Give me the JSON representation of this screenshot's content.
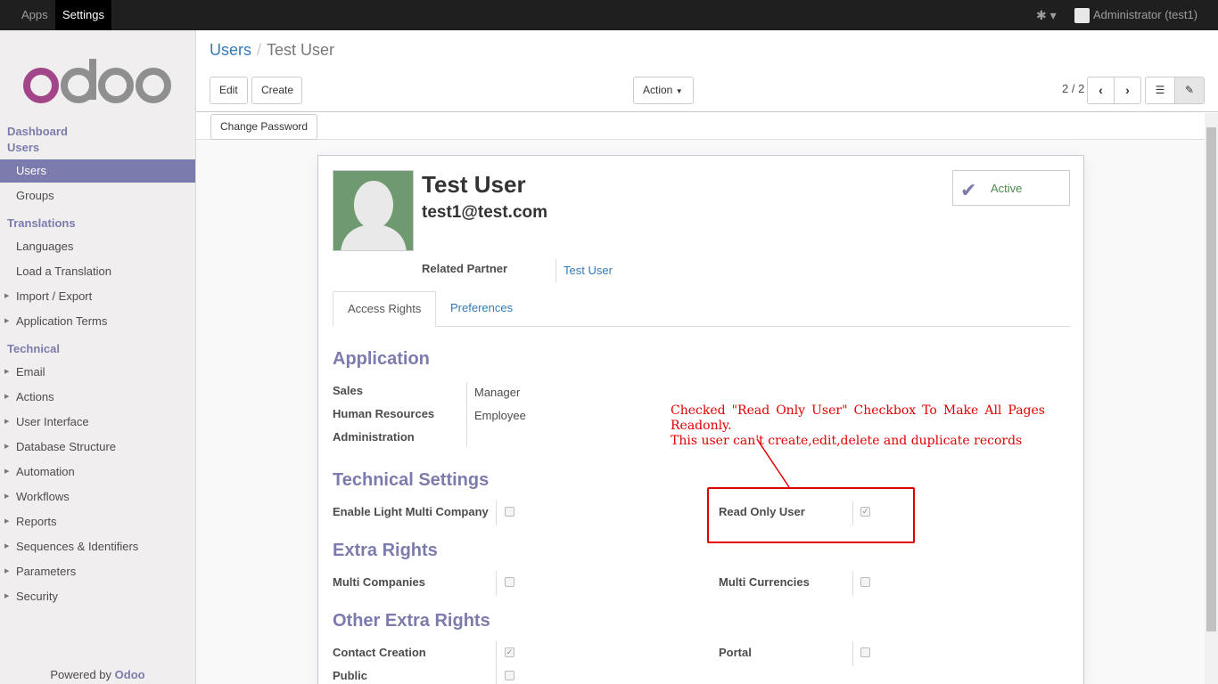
{
  "topbar": {
    "apps_label": "Apps",
    "settings_label": "Settings",
    "user_label": "Administrator (test1)"
  },
  "sidebar": {
    "logo_text": "odoo",
    "sections": {
      "dashboard": "Dashboard",
      "users": "Users",
      "translations": "Translations",
      "technical": "Technical"
    },
    "items": {
      "users": "Users",
      "groups": "Groups",
      "languages": "Languages",
      "load_translation": "Load a Translation",
      "import_export": "Import / Export",
      "application_terms": "Application Terms",
      "email": "Email",
      "actions": "Actions",
      "user_interface": "User Interface",
      "database_structure": "Database Structure",
      "automation": "Automation",
      "workflows": "Workflows",
      "reports": "Reports",
      "sequences": "Sequences & Identifiers",
      "parameters": "Parameters",
      "security": "Security"
    },
    "powered_by": "Powered by",
    "powered_brand": "Odoo"
  },
  "control": {
    "breadcrumb_parent": "Users",
    "breadcrumb_sep": "/",
    "breadcrumb_current": "Test User",
    "edit_label": "Edit",
    "create_label": "Create",
    "action_label": "Action",
    "pager": "2 / 2"
  },
  "statusbar": {
    "change_password_label": "Change Password"
  },
  "form": {
    "name": "Test User",
    "email": "test1@test.com",
    "active_label": "Active",
    "related_partner_label": "Related Partner",
    "related_partner_value": "Test User",
    "tabs": {
      "access_rights": "Access Rights",
      "preferences": "Preferences"
    },
    "application": {
      "title": "Application",
      "sales_label": "Sales",
      "sales_value": "Manager",
      "hr_label": "Human Resources",
      "hr_value": "Employee",
      "admin_label": "Administration"
    },
    "technical": {
      "title": "Technical Settings",
      "light_multi_company": "Enable Light Multi Company",
      "read_only_user": "Read Only User"
    },
    "extra": {
      "title": "Extra Rights",
      "multi_companies": "Multi Companies",
      "multi_currencies": "Multi Currencies"
    },
    "other_extra": {
      "title": "Other Extra Rights",
      "contact_creation": "Contact Creation",
      "portal": "Portal",
      "public": "Public"
    }
  },
  "annotation": {
    "line1": "Checked \"Read Only User\" Checkbox To Make All Pages Readonly.",
    "line2": "This user can't create,edit,delete and duplicate records",
    "color": "#e00000"
  }
}
